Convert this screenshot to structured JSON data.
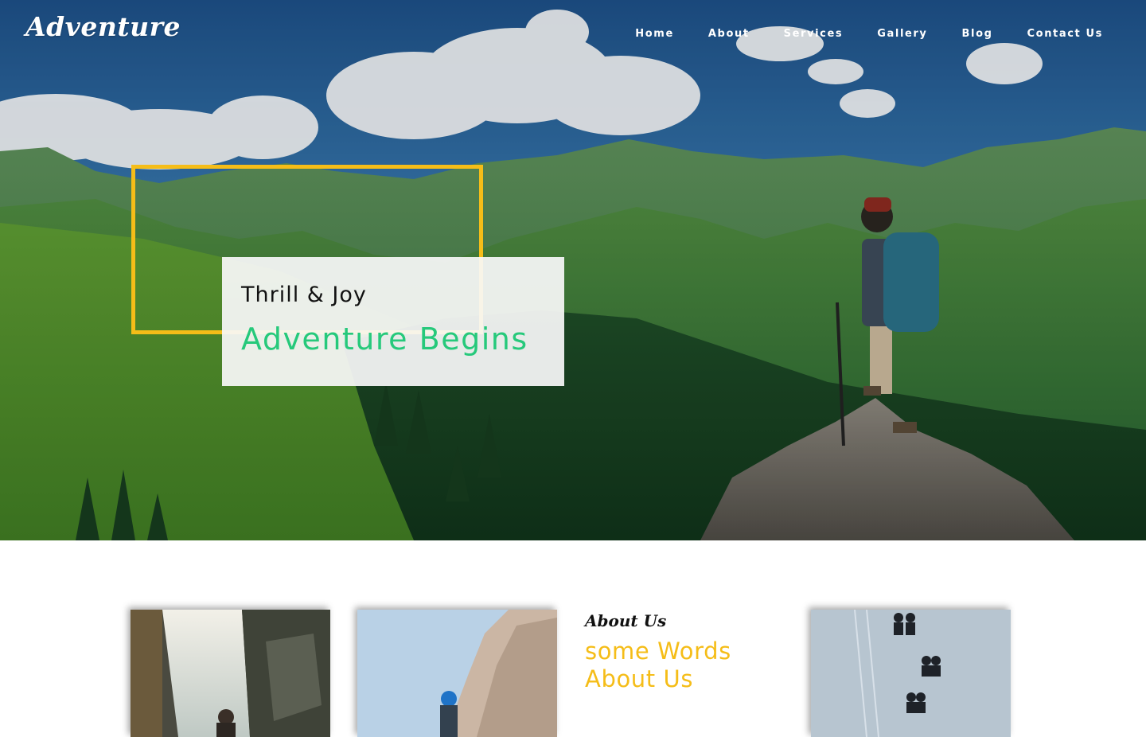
{
  "brand": {
    "logo_text": "Adventure"
  },
  "nav": {
    "items": [
      {
        "label": "Home"
      },
      {
        "label": "About"
      },
      {
        "label": "Services"
      },
      {
        "label": "Gallery"
      },
      {
        "label": "Blog"
      },
      {
        "label": "Contact Us"
      }
    ]
  },
  "hero": {
    "kicker": "Thrill & Joy",
    "title": "Adventure Begins",
    "accent_color": "#26c97b",
    "frame_color": "#f5bd18"
  },
  "about": {
    "small_title": "About Us",
    "heading_line1": "some Words",
    "heading_line2": "About Us",
    "heading_color": "#f5bd18"
  }
}
